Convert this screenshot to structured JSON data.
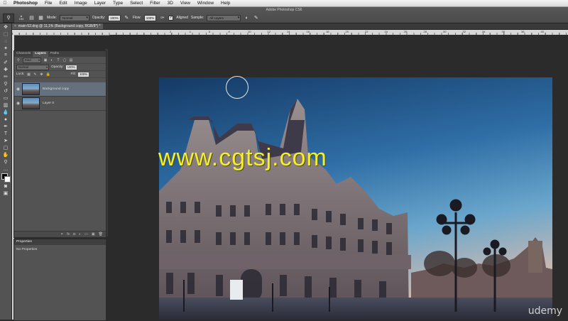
{
  "menubar": {
    "app": "Photoshop",
    "items": [
      "File",
      "Edit",
      "Image",
      "Layer",
      "Type",
      "Select",
      "Filter",
      "3D",
      "View",
      "Window",
      "Help"
    ]
  },
  "window": {
    "title": "Adobe Photoshop CS6"
  },
  "options_bar": {
    "brush_size": "194",
    "mode_label": "Mode:",
    "mode_value": "Normal",
    "opacity_label": "Opacity:",
    "opacity_value": "100%",
    "flow_label": "Flow:",
    "flow_value": "100%",
    "aligned_label": "Aligned",
    "sample_label": "Sample:",
    "sample_value": "All Layers"
  },
  "document": {
    "tab_label": "main-52.dng @ 11,1% (Background copy, RGB/8*) *"
  },
  "ruler": {
    "numbers": [
      "2",
      "4",
      "6",
      "8",
      "10",
      "12",
      "14",
      "16",
      "18",
      "20",
      "22",
      "24",
      "26",
      "28",
      "30",
      "32",
      "34",
      "36",
      "38",
      "40"
    ]
  },
  "layers_panel": {
    "tabs": [
      "Channels",
      "Layers",
      "Paths"
    ],
    "active_tab": "Layers",
    "kind_label": "Kind",
    "blend_mode": "Normal",
    "opacity_label": "Opacity:",
    "opacity_value": "100%",
    "lock_label": "Lock:",
    "fill_label": "Fill:",
    "fill_value": "100%",
    "layers": [
      {
        "name": "Background copy",
        "selected": true
      },
      {
        "name": "Layer 0",
        "selected": false
      }
    ]
  },
  "properties_panel": {
    "title": "Properties",
    "empty_text": "No Properties"
  },
  "canvas": {
    "watermark": "www.cgtsj.com",
    "brand": "udemy"
  }
}
